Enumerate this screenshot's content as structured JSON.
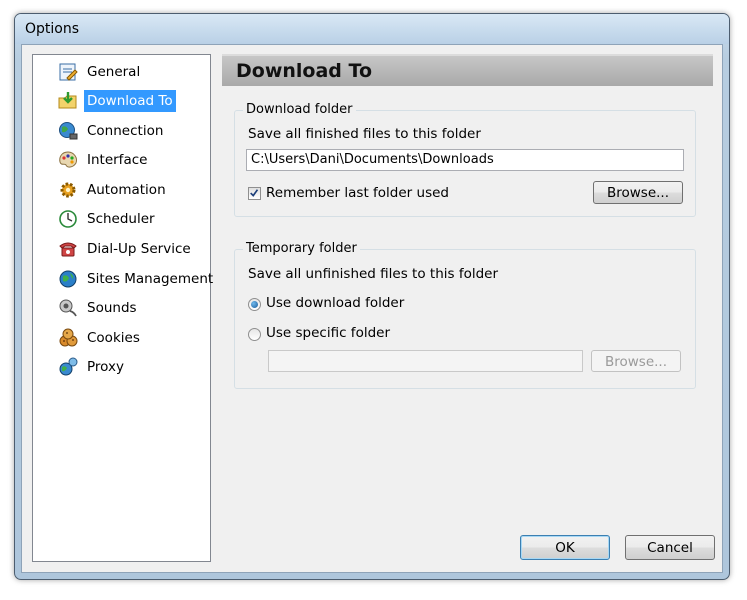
{
  "window": {
    "title": "Options"
  },
  "sidebar": {
    "items": [
      {
        "label": "General",
        "icon": "general-icon"
      },
      {
        "label": "Download To",
        "icon": "download-to-icon",
        "selected": true
      },
      {
        "label": "Connection",
        "icon": "connection-icon"
      },
      {
        "label": "Interface",
        "icon": "interface-icon"
      },
      {
        "label": "Automation",
        "icon": "automation-icon"
      },
      {
        "label": "Scheduler",
        "icon": "scheduler-icon"
      },
      {
        "label": "Dial-Up Service",
        "icon": "dial-up-icon"
      },
      {
        "label": "Sites Management",
        "icon": "sites-management-icon"
      },
      {
        "label": "Sounds",
        "icon": "sounds-icon"
      },
      {
        "label": "Cookies",
        "icon": "cookies-icon"
      },
      {
        "label": "Proxy",
        "icon": "proxy-icon"
      }
    ]
  },
  "panel": {
    "title": "Download To",
    "download_folder": {
      "legend": "Download folder",
      "description": "Save all finished files to this folder",
      "path_value": "C:\\Users\\Dani\\Documents\\Downloads",
      "remember_label": "Remember last folder used",
      "remember_checked": true,
      "browse_label": "Browse..."
    },
    "temporary_folder": {
      "legend": "Temporary folder",
      "description": "Save all unfinished files to this folder",
      "use_download_label": "Use download folder",
      "use_download_selected": true,
      "use_specific_label": "Use specific folder",
      "use_specific_selected": false,
      "specific_path_value": "",
      "browse_label": "Browse..."
    }
  },
  "footer": {
    "ok_label": "OK",
    "cancel_label": "Cancel"
  },
  "colors": {
    "selection": "#3399ff",
    "header_bg": "#b5b5b5"
  }
}
